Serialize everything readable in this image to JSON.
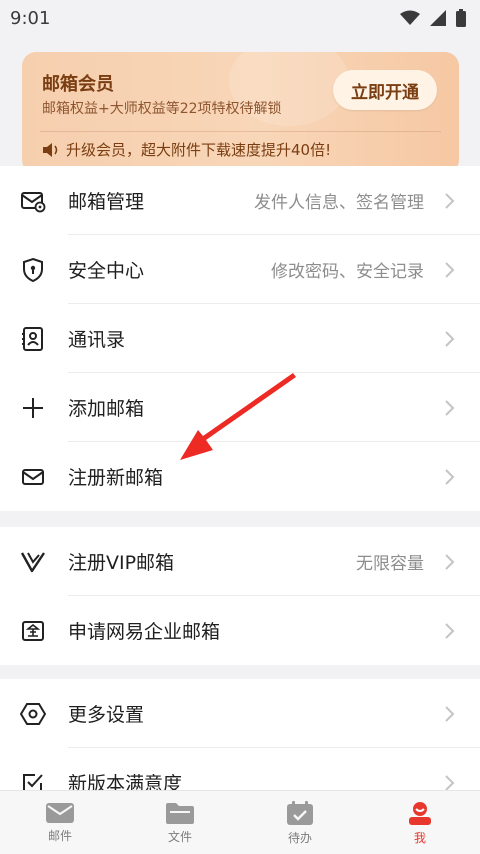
{
  "status_bar": {
    "time": "9:01"
  },
  "vip": {
    "title": "邮箱会员",
    "subtitle": "邮箱权益+大师权益等22项特权待解锁",
    "button_label": "立即开通",
    "notice": "升级会员，超大附件下载速度提升40倍!"
  },
  "group1": {
    "items": [
      {
        "label": "邮箱管理",
        "detail": "发件人信息、签名管理",
        "icon": "mail-settings-icon"
      },
      {
        "label": "安全中心",
        "detail": "修改密码、安全记录",
        "icon": "shield-icon"
      },
      {
        "label": "通讯录",
        "detail": "",
        "icon": "contacts-icon"
      },
      {
        "label": "添加邮箱",
        "detail": "",
        "icon": "plus-icon"
      },
      {
        "label": "注册新邮箱",
        "detail": "",
        "icon": "envelope-icon"
      }
    ]
  },
  "group2": {
    "items": [
      {
        "label": "注册VIP邮箱",
        "detail": "无限容量",
        "icon": "vip-logo-icon"
      },
      {
        "label": "申请网易企业邮箱",
        "detail": "",
        "icon": "enterprise-icon"
      }
    ]
  },
  "group3": {
    "items": [
      {
        "label": "更多设置",
        "detail": "",
        "icon": "hexagon-settings-icon"
      },
      {
        "label": "新版本满意度",
        "detail": "",
        "icon": "checkbox-icon"
      }
    ]
  },
  "bottom_nav": {
    "items": [
      {
        "label": "邮件",
        "icon": "mail-icon",
        "active": false
      },
      {
        "label": "文件",
        "icon": "folder-icon",
        "active": false
      },
      {
        "label": "待办",
        "icon": "calendar-check-icon",
        "active": false
      },
      {
        "label": "我",
        "icon": "profile-icon",
        "active": true
      }
    ]
  },
  "colors": {
    "accent": "#e8382d",
    "vip_text": "#7a3e12",
    "annotation_arrow": "#ee2a24"
  }
}
